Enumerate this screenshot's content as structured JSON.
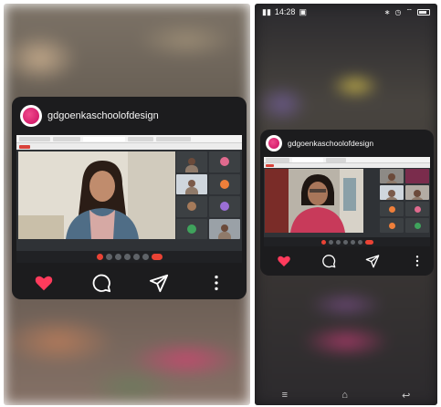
{
  "left_phone": {
    "post": {
      "account": "gdgoenkaschoolofdesign",
      "actions": [
        "heart-icon",
        "comment-icon",
        "send-icon",
        "more-icon"
      ]
    }
  },
  "right_phone": {
    "status_bar": {
      "time": "14:28"
    },
    "post": {
      "account": "gdgoenkaschoolofdesign",
      "actions": [
        "heart-icon",
        "comment-icon",
        "send-icon",
        "more-icon"
      ]
    },
    "nav_bar": [
      "menu-icon",
      "home-icon",
      "back-icon"
    ]
  },
  "colors": {
    "card_background": "#1c1c1e",
    "heart": "#ff3b5c",
    "avatar_accent": "#d51f6d",
    "meet_background": "#2f3236",
    "end_call": "#ea4335"
  }
}
